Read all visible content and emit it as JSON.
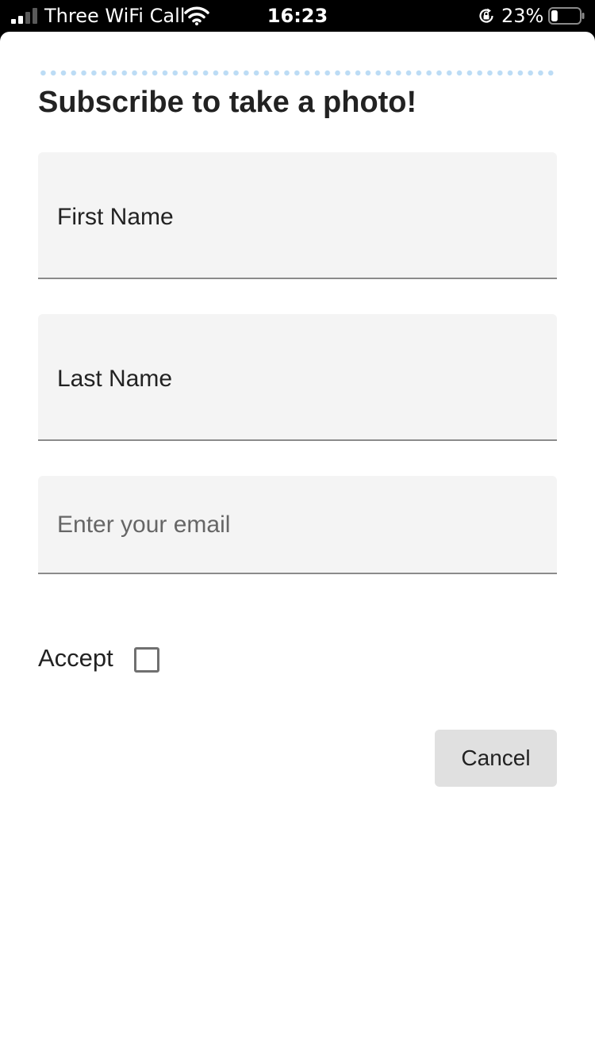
{
  "status_bar": {
    "carrier": "Three WiFi Call",
    "time": "16:23",
    "battery_percent": "23%",
    "battery_level": 0.23,
    "signal_bars": 2,
    "icons": [
      "signal-icon",
      "wifi-icon",
      "rotation-lock-icon",
      "battery-icon"
    ]
  },
  "form": {
    "title": "Subscribe to take a photo!",
    "first_name": {
      "value": "First Name",
      "placeholder": ""
    },
    "last_name": {
      "value": "Last Name",
      "placeholder": ""
    },
    "email": {
      "value": "",
      "placeholder": "Enter your email"
    },
    "accept_label": "Accept",
    "accept_checked": false,
    "cancel_label": "Cancel"
  },
  "colors": {
    "status_bar_bg": "#000000",
    "sheet_bg": "#ffffff",
    "field_bg": "#f4f4f4",
    "field_underline": "#8b8b8b",
    "dotted_rule": "#bcdcf5",
    "button_bg": "#e0e0e0",
    "text": "#222222"
  }
}
